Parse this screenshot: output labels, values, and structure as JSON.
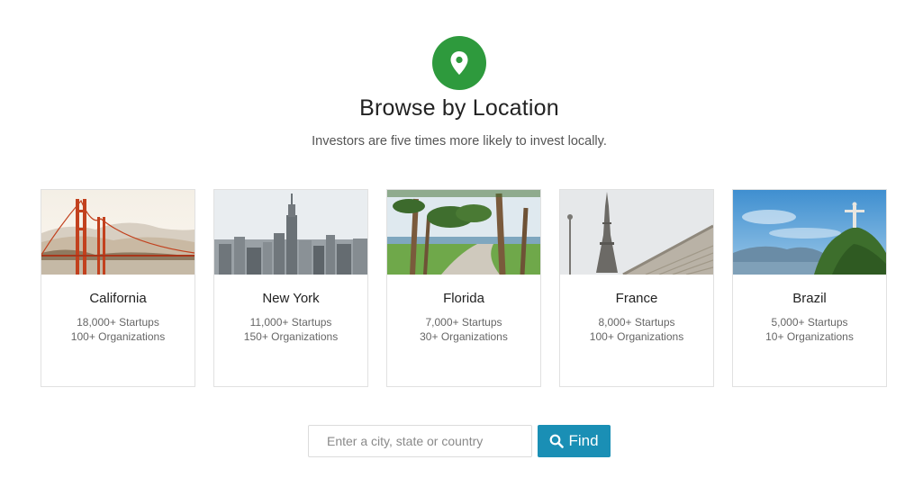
{
  "header": {
    "icon": "map-pin-icon",
    "title": "Browse by Location",
    "subtitle": "Investors are five times more likely to invest locally."
  },
  "locations": [
    {
      "name": "California",
      "startups": "18,000+ Startups",
      "organizations": "100+ Organizations",
      "image": "golden-gate-bridge-photo"
    },
    {
      "name": "New York",
      "startups": "11,000+ Startups",
      "organizations": "150+ Organizations",
      "image": "empire-state-skyline-photo"
    },
    {
      "name": "Florida",
      "startups": "7,000+ Startups",
      "organizations": "30+ Organizations",
      "image": "palm-trees-path-photo"
    },
    {
      "name": "France",
      "startups": "8,000+ Startups",
      "organizations": "100+ Organizations",
      "image": "eiffel-tower-photo"
    },
    {
      "name": "Brazil",
      "startups": "5,000+ Startups",
      "organizations": "10+ Organizations",
      "image": "christ-the-redeemer-photo"
    }
  ],
  "search": {
    "placeholder": "Enter a city, state or country",
    "value": "",
    "button_label": "Find",
    "button_icon": "search-icon"
  },
  "colors": {
    "pin_badge": "#2e9a3d",
    "find_button": "#1a8fb5"
  }
}
